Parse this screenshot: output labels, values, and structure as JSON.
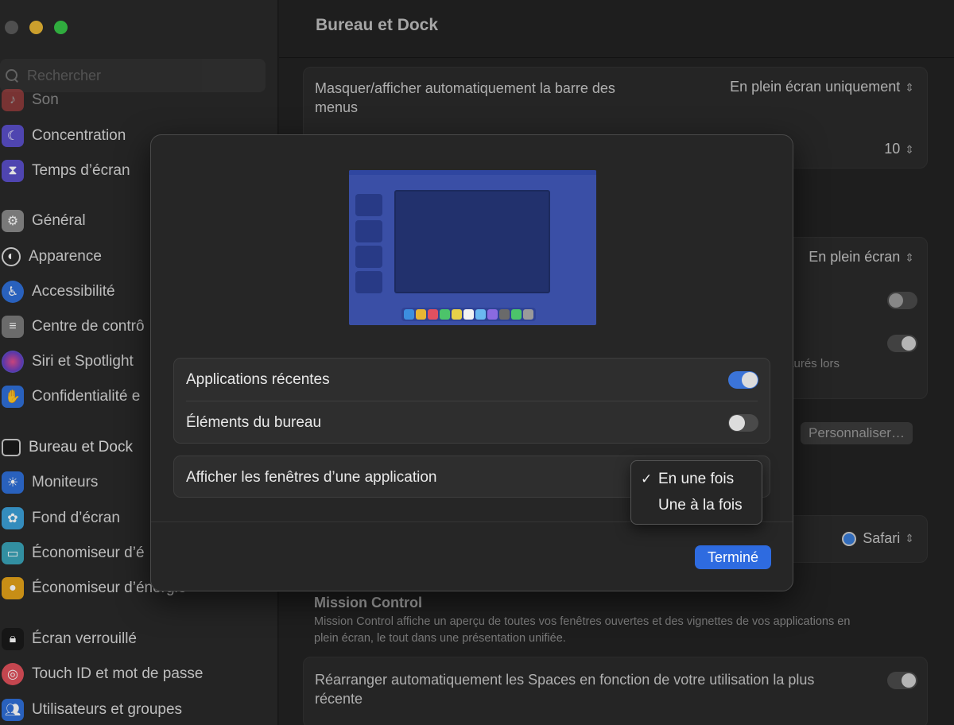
{
  "sidebar": {
    "search_placeholder": "Rechercher",
    "items": [
      {
        "label": "Son",
        "icon": "speaker-icon",
        "color": "#d84a4a"
      },
      {
        "label": "Concentration",
        "icon": "moon-icon",
        "color": "#5b4fc9"
      },
      {
        "label": "Temps d’écran",
        "icon": "hourglass-icon",
        "color": "#5b4fc9"
      },
      {
        "label": "Général",
        "icon": "gear-icon",
        "color": "#8a8a8a"
      },
      {
        "label": "Apparence",
        "icon": "appearance-icon",
        "color": "#2a2a2a"
      },
      {
        "label": "Accessibilité",
        "icon": "accessibility-icon",
        "color": "#2f6fd8"
      },
      {
        "label": "Centre de contrô",
        "icon": "control-center-icon",
        "color": "#7a7a7a"
      },
      {
        "label": "Siri et Spotlight",
        "icon": "siri-icon",
        "color": "#7a3fb5"
      },
      {
        "label": "Confidentialité e",
        "icon": "hand-icon",
        "color": "#2f6fd8"
      },
      {
        "label": "Bureau et Dock",
        "icon": "dock-icon",
        "color": "#1a1a1a"
      },
      {
        "label": "Moniteurs",
        "icon": "sun-icon",
        "color": "#2f6fd8"
      },
      {
        "label": "Fond d’écran",
        "icon": "wallpaper-icon",
        "color": "#3ca0d8"
      },
      {
        "label": "Économiseur d’é",
        "icon": "screensaver-icon",
        "color": "#3aa3b8"
      },
      {
        "label": "Économiseur d’énergie",
        "icon": "bulb-icon",
        "color": "#e3a21a"
      },
      {
        "label": "Écran verrouillé",
        "icon": "lock-icon",
        "color": "#1a1a1a"
      },
      {
        "label": "Touch ID et mot de passe",
        "icon": "fingerprint-icon",
        "color": "#e0505a"
      },
      {
        "label": "Utilisateurs et groupes",
        "icon": "users-icon",
        "color": "#2f6fd8"
      }
    ]
  },
  "main": {
    "title": "Bureau et Dock",
    "menubar_label": "Masquer/afficher automatiquement la barre des menus",
    "menubar_value": "En plein écran uniquement",
    "recent_count": "10",
    "fullscreen_value": "En plein écran",
    "restored_partial": "staurés lors",
    "customize_button": "Personnaliser…",
    "browser_value": "Safari",
    "mission_title": "Mission Control",
    "mission_desc": "Mission Control affiche un aperçu de toutes vos fenêtres ouvertes et des vignettes de vos applications en plein écran, le tout dans une présentation unifiée.",
    "spaces_label": "Réarranger automatiquement les Spaces en fonction de votre utilisation la plus récente"
  },
  "modal": {
    "recent_apps_label": "Applications récentes",
    "recent_apps_on": true,
    "desktop_items_label": "Éléments du bureau",
    "desktop_items_on": false,
    "show_windows_label": "Afficher les fenêtres d’une application",
    "done_button": "Terminé"
  },
  "dropdown": {
    "options": [
      "En une fois",
      "Une à la fois"
    ],
    "selected": "En une fois",
    "check": "✓"
  },
  "colors": {
    "accent": "#2e6be0",
    "toggle_on": "#3b74d8",
    "preview_bg": "#3a4fa6"
  }
}
